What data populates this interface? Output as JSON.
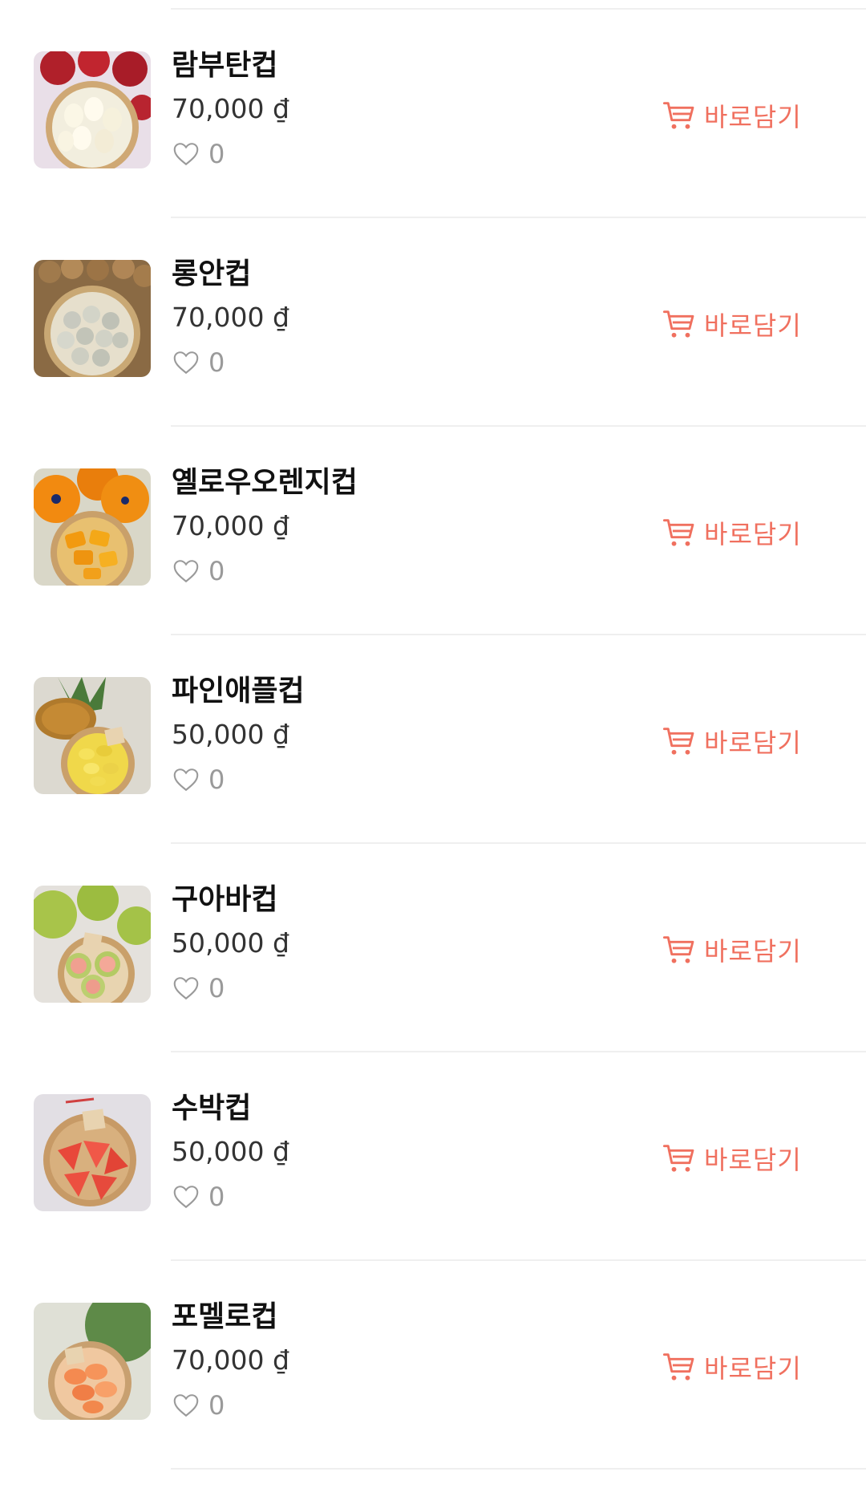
{
  "currency_symbol": "₫",
  "accent_color": "#f0705f",
  "cart_button_label": "바로담기",
  "products": [
    {
      "name": "람부탄컵",
      "price": "70,000 ₫",
      "likes": "0",
      "image": "rambutan-cup-photo"
    },
    {
      "name": "롱안컵",
      "price": "70,000 ₫",
      "likes": "0",
      "image": "longan-cup-photo"
    },
    {
      "name": "옐로우오렌지컵",
      "price": "70,000 ₫",
      "likes": "0",
      "image": "yellow-orange-cup-photo"
    },
    {
      "name": "파인애플컵",
      "price": "50,000 ₫",
      "likes": "0",
      "image": "pineapple-cup-photo"
    },
    {
      "name": "구아바컵",
      "price": "50,000 ₫",
      "likes": "0",
      "image": "guava-cup-photo"
    },
    {
      "name": "수박컵",
      "price": "50,000 ₫",
      "likes": "0",
      "image": "watermelon-cup-photo"
    },
    {
      "name": "포멜로컵",
      "price": "70,000 ₫",
      "likes": "0",
      "image": "pomelo-cup-photo"
    }
  ]
}
